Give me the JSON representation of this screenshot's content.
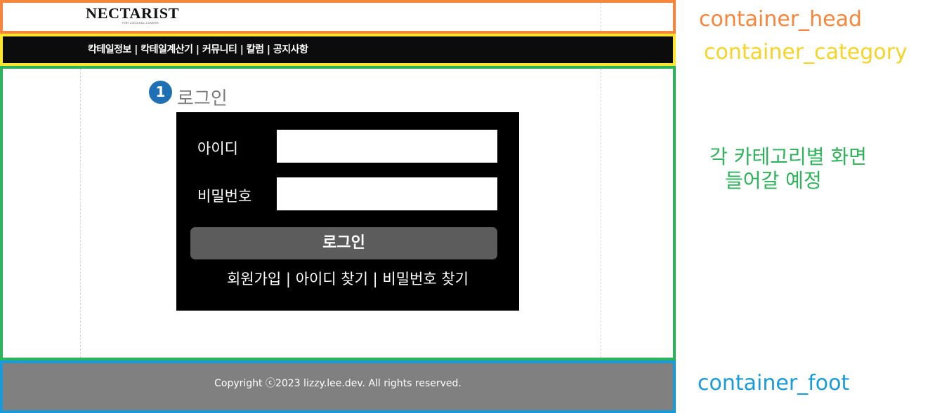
{
  "header": {
    "logo_text": "NECTARIST",
    "logo_sub": "FOR COCKTAIL LOVERS"
  },
  "category": {
    "menu_text": "칵테일정보 | 칵테일계산기 | 커뮤니티 | 칼럼 | 공지사항"
  },
  "main": {
    "step_badge": "1",
    "title": "로그인",
    "form": {
      "id_label": "아이디",
      "id_value": "",
      "pw_label": "비밀번호",
      "pw_value": "",
      "login_button": "로그인",
      "signup_link": "회원가입",
      "find_id_link": "아이디 찾기",
      "find_pw_link": "비밀번호 찾기",
      "separator": " | "
    }
  },
  "footer": {
    "copyright": "Copyright ⓒ2023 lizzy.lee.dev. All rights reserved."
  },
  "annotations": {
    "head": "container_head",
    "category": "container_category",
    "main_line1": "각 카테고리별 화면",
    "main_line2": "들어갈 예정",
    "foot": "container_foot"
  },
  "colors": {
    "head_border": "#f5863b",
    "category_border": "#fde52e",
    "main_border": "#2db35a",
    "foot_border": "#1a9bd7",
    "badge": "#1f6fb5"
  }
}
